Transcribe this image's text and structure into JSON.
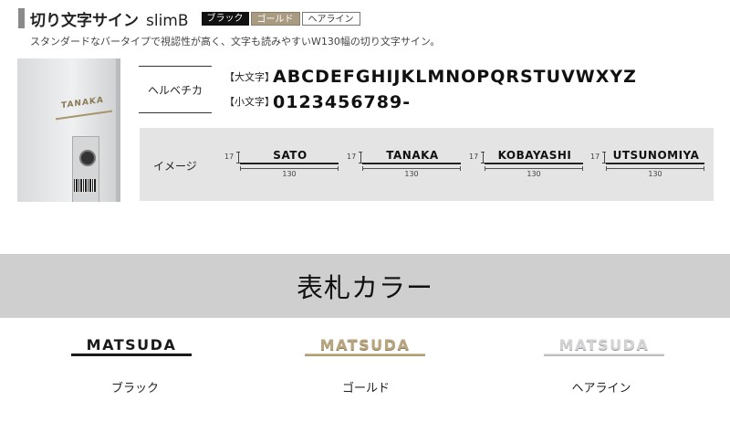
{
  "header": {
    "title": "切り文字サイン",
    "title_latin": "slimB",
    "tags": [
      "ブラック",
      "ゴールド",
      "ヘアライン"
    ]
  },
  "description": "スタンダードなバータイプで視認性が高く、文字も読みやすいW130幅の切り文字サイン。",
  "photo": {
    "plate_text": "TANAKA"
  },
  "font": {
    "name": "ヘルベチカ",
    "uppercase_label": "【大文字】",
    "uppercase_sample": "ABCDEFGHIJKLMNOPQRSTUVWXYZ",
    "lowercase_label": "【小文字】",
    "lowercase_sample": "0123456789-"
  },
  "image_section": {
    "label": "イメージ",
    "samples": [
      {
        "word": "SATO",
        "height": "17",
        "width": "130"
      },
      {
        "word": "TANAKA",
        "height": "17",
        "width": "130"
      },
      {
        "word": "KOBAYASHI",
        "height": "17",
        "width": "130"
      },
      {
        "word": "UTSUNOMIYA",
        "height": "17",
        "width": "130"
      }
    ]
  },
  "colors": {
    "heading": "表札カラー",
    "items": [
      {
        "sample": "MATSUDA",
        "name": "ブラック",
        "hex": "#1a1a1a"
      },
      {
        "sample": "MATSUDA",
        "name": "ゴールド",
        "hex": "#b8a680"
      },
      {
        "sample": "MATSUDA",
        "name": "ヘアライン",
        "hex": "#d2d4d6"
      }
    ]
  }
}
